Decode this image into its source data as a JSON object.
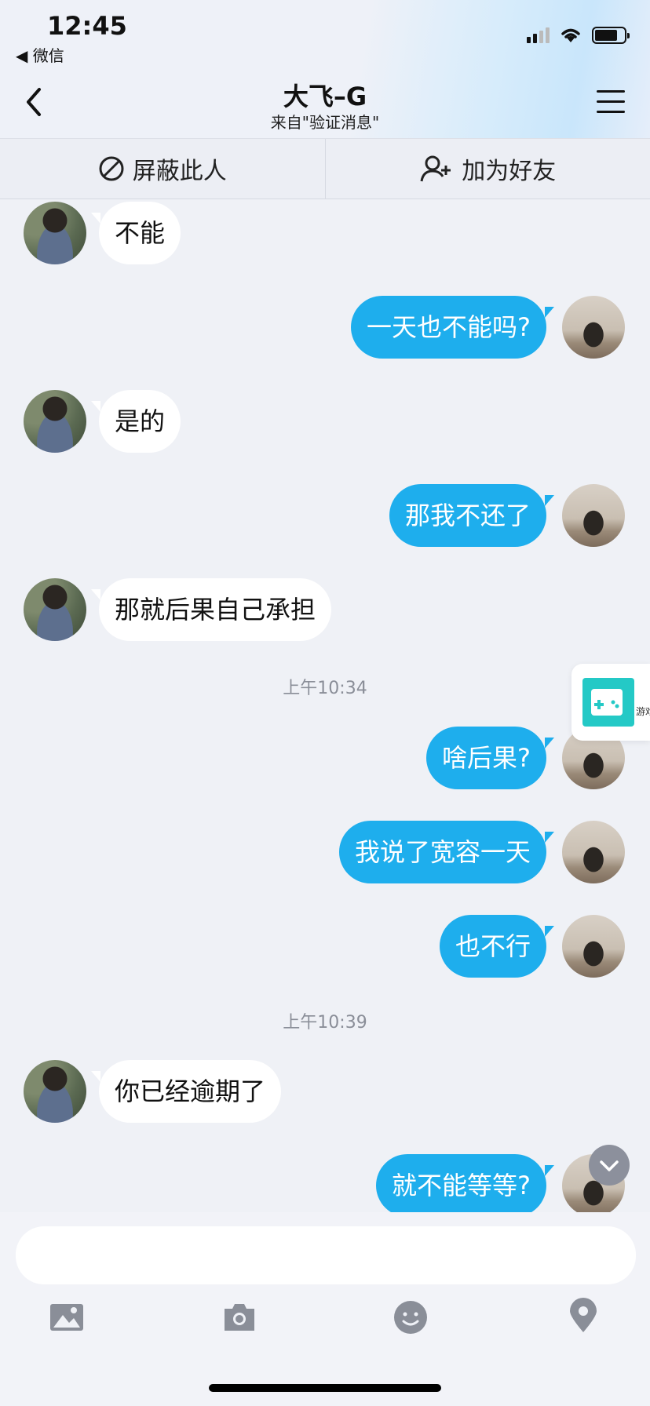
{
  "status": {
    "time": "12:45",
    "back_app": "◀ 微信"
  },
  "header": {
    "title": "大飞–G",
    "subtitle": "来自\"验证消息\""
  },
  "actions": {
    "block": "屏蔽此人",
    "add_friend": "加为好友"
  },
  "messages": [
    {
      "side": "in",
      "text": "不能"
    },
    {
      "side": "out",
      "text": "一天也不能吗?"
    },
    {
      "side": "in",
      "text": "是的"
    },
    {
      "side": "out",
      "text": "那我不还了"
    },
    {
      "side": "in",
      "text": "那就后果自己承担"
    },
    {
      "side": "out",
      "text": "啥后果?"
    },
    {
      "side": "out",
      "text": "我说了宽容一天"
    },
    {
      "side": "out",
      "text": "也不行"
    },
    {
      "side": "in",
      "text": "你已经逾期了"
    },
    {
      "side": "out",
      "text": "就不能等等?"
    }
  ],
  "timestamps": [
    "上午10:34",
    "上午10:39"
  ],
  "float_card": {
    "label": "游戏"
  },
  "input": {
    "placeholder": ""
  },
  "toolbar": {
    "icons": [
      "image-icon",
      "camera-icon",
      "emoji-icon",
      "location-icon"
    ]
  },
  "colors": {
    "out_bubble": "#1eaeed",
    "in_bubble": "#ffffff",
    "background": "#eff1f6",
    "game_accent": "#24c9c6"
  }
}
